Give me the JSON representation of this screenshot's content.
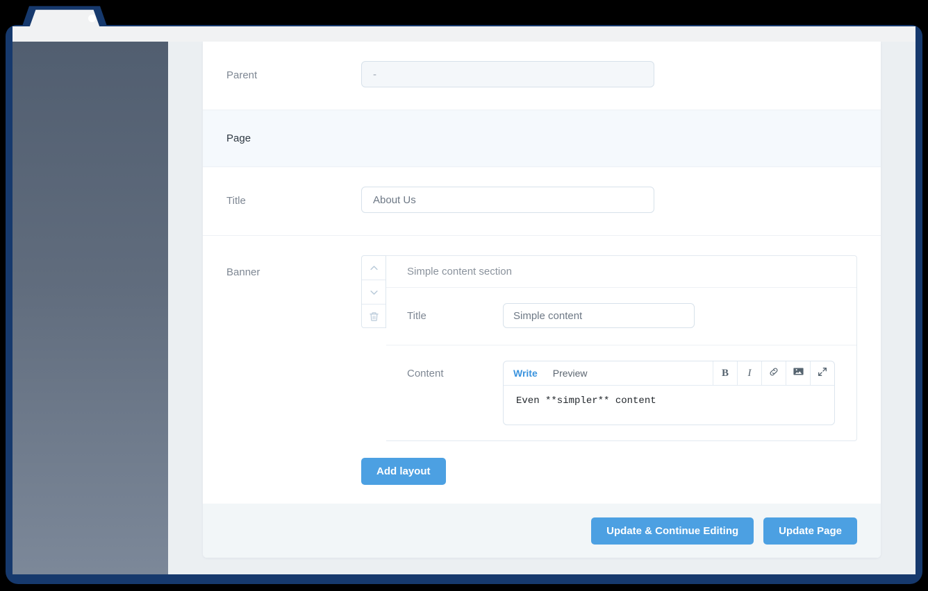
{
  "window": {
    "frame_color": "#16396D",
    "toolbar_color": "#F1F2F3",
    "screen_bg": "#EBEFF2"
  },
  "sidebar": {
    "gradient_from": "#515E70",
    "gradient_to": "#7C8899"
  },
  "form": {
    "parent": {
      "label": "Parent",
      "value": "-",
      "disabled": true
    },
    "section_page": {
      "title": "Page"
    },
    "title": {
      "label": "Title",
      "value": "About Us"
    },
    "banner": {
      "label": "Banner",
      "controls": {
        "move_up": "Move up",
        "move_down": "Move down",
        "delete": "Delete"
      },
      "layout": {
        "header": "Simple content section",
        "title_field": {
          "label": "Title",
          "value": "Simple content"
        },
        "content_field": {
          "label": "Content",
          "tabs": [
            {
              "label": "Write",
              "active": true
            },
            {
              "label": "Preview",
              "active": false
            }
          ],
          "tools": [
            {
              "name": "bold",
              "glyph": "B"
            },
            {
              "name": "italic",
              "glyph": "I"
            },
            {
              "name": "link",
              "glyph": ""
            },
            {
              "name": "image",
              "glyph": ""
            },
            {
              "name": "fullscreen",
              "glyph": ""
            }
          ],
          "value": "Even **simpler** content"
        }
      },
      "add_layout_label": "Add layout"
    }
  },
  "footer": {
    "update_continue_label": "Update & Continue Editing",
    "update_page_label": "Update Page"
  },
  "colors": {
    "accent_blue": "#4CA0E2",
    "link_blue": "#3A93DE",
    "band_blue": "#F5F9FD",
    "footer_gray": "#F2F6F8"
  }
}
